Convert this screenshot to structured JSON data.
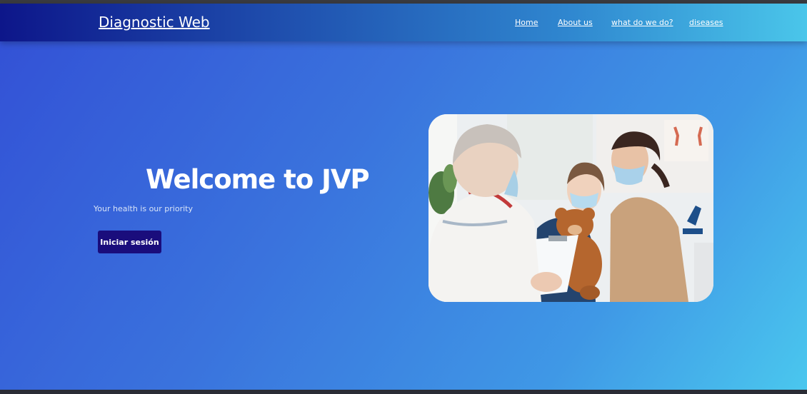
{
  "navbar": {
    "brand": "Diagnostic Web",
    "links": [
      {
        "label": "Home"
      },
      {
        "label": "About us"
      },
      {
        "label": "what do we do?"
      },
      {
        "label": "diseases"
      }
    ]
  },
  "hero": {
    "title": "Welcome to JVP",
    "subtitle": "Your health is our priority",
    "login_button": "Iniciar sesión",
    "image": {
      "description_icon": "doctor-patient-photo"
    }
  },
  "colors": {
    "navbar_start": "#0d168a",
    "navbar_end": "#4ac6ea",
    "hero_start": "#3352d6",
    "hero_end": "#4ac7ee",
    "button": "#1a0d7c"
  }
}
